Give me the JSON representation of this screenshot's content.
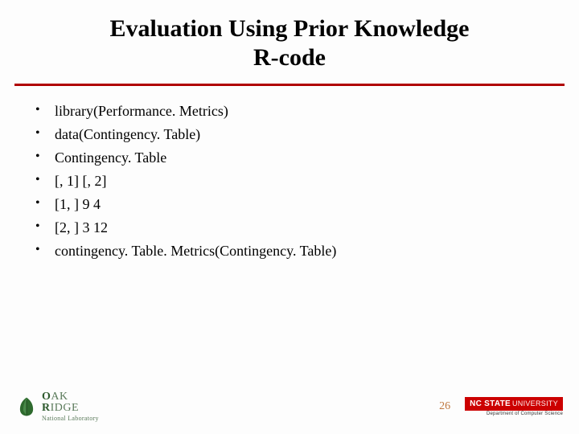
{
  "title_line1": "Evaluation Using Prior Knowledge",
  "title_line2": "R-code",
  "bullets": [
    "library(Performance. Metrics)",
    "data(Contingency. Table)",
    "Contingency. Table",
    "[, 1] [, 2]",
    "[1, ] 9 4",
    "[2, ] 3 12",
    "contingency. Table. Metrics(Contingency. Table)"
  ],
  "page_number": "26",
  "logo_left": {
    "line1_a": "O",
    "line1_b": "AK",
    "line1_c": "R",
    "line1_d": "IDGE",
    "line2": "National Laboratory"
  },
  "logo_right": {
    "main": "NC STATE",
    "suffix": "UNIVERSITY",
    "sub": "Department of Computer Science"
  }
}
